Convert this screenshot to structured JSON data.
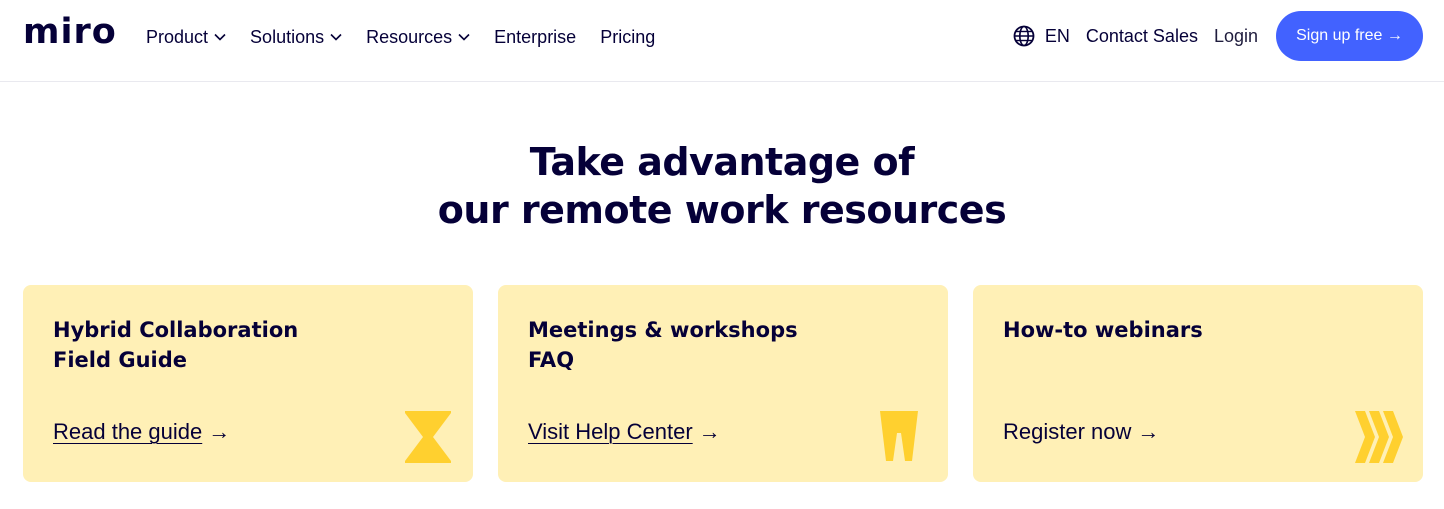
{
  "nav": {
    "logo": "miro",
    "items": [
      {
        "label": "Product",
        "dropdown": true
      },
      {
        "label": "Solutions",
        "dropdown": true
      },
      {
        "label": "Resources",
        "dropdown": true
      },
      {
        "label": "Enterprise",
        "dropdown": false
      },
      {
        "label": "Pricing",
        "dropdown": false
      }
    ],
    "language": "EN",
    "contact": "Contact Sales",
    "login": "Login",
    "signup": "Sign up free →"
  },
  "hero": {
    "line1": "Take advantage of",
    "line2": "our remote work resources"
  },
  "cards": [
    {
      "title": "Hybrid Collaboration\nField Guide",
      "link": "Read the guide",
      "arrow": "→",
      "icon": "hourglass-icon"
    },
    {
      "title": "Meetings & workshops FAQ",
      "link": "Visit Help Center",
      "arrow": "→",
      "icon": "tooth-icon"
    },
    {
      "title": "How-to webinars",
      "link": "Register now",
      "arrow": "→",
      "icon": "chevrons-icon"
    }
  ],
  "colors": {
    "brand_text": "#050038",
    "accent": "#4262ff",
    "card_bg": "#fff0b6",
    "icon_yellow": "#ffd02f"
  }
}
